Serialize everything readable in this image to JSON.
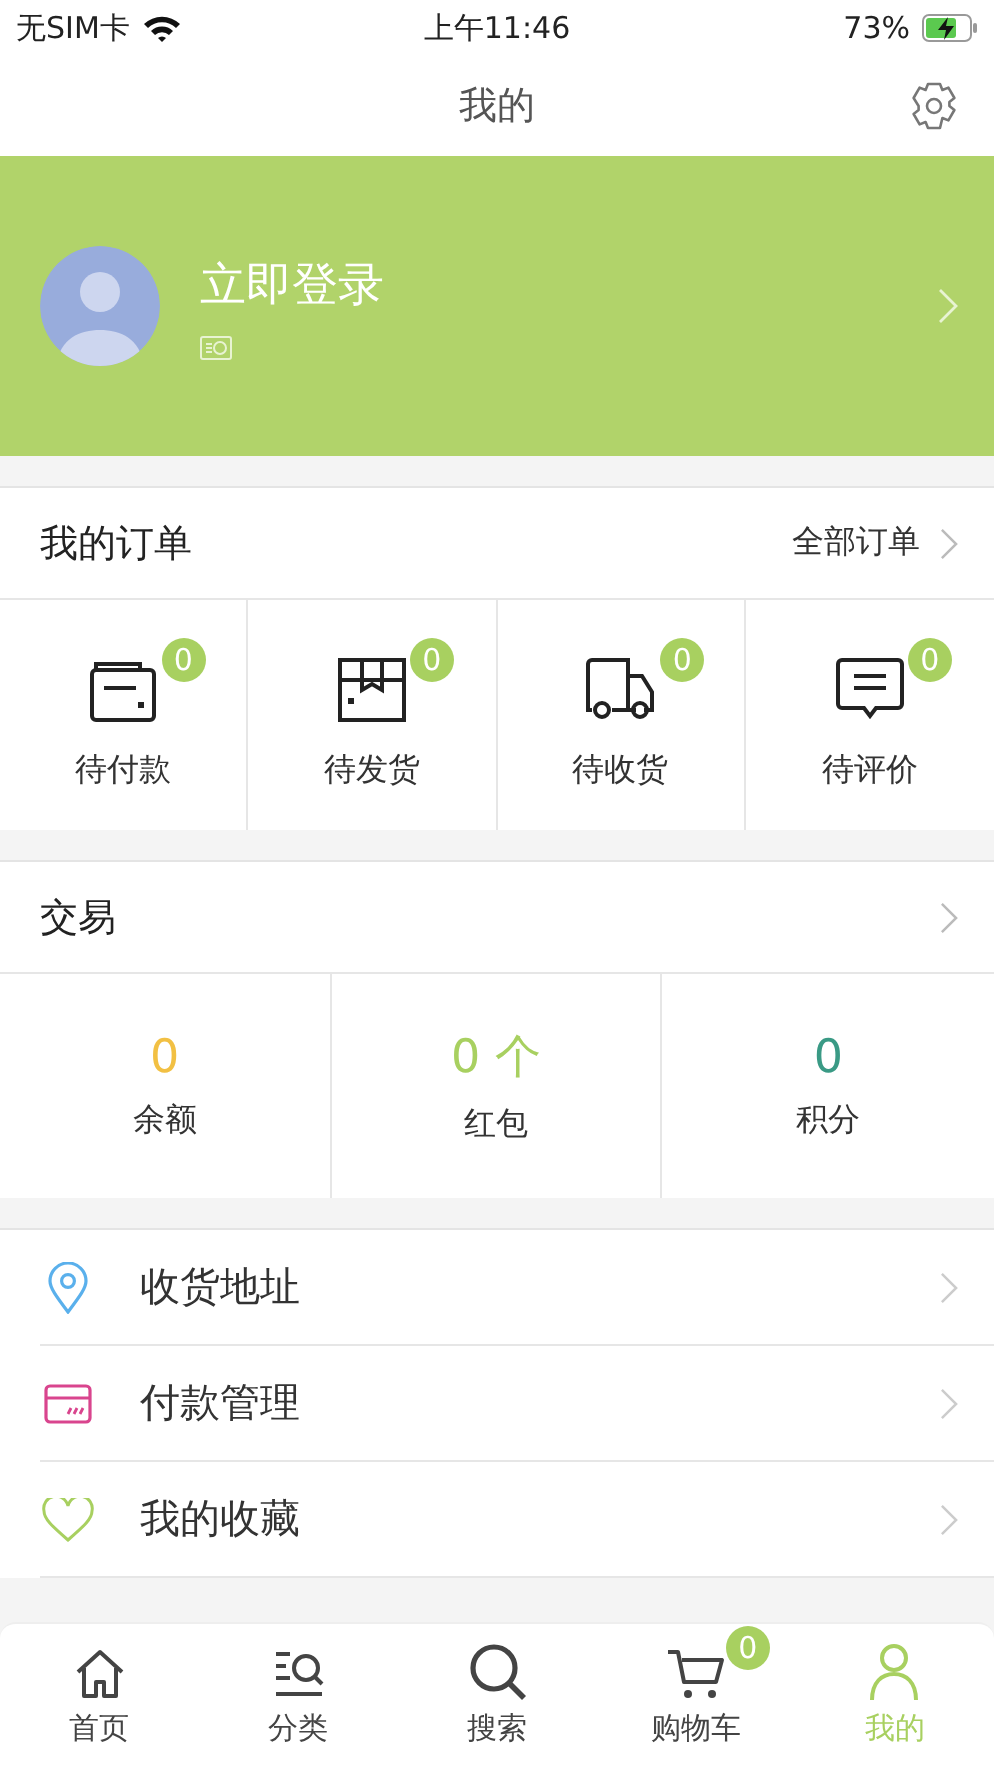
{
  "status_bar": {
    "carrier": "无SIM卡",
    "time": "上午11:46",
    "battery": "73%"
  },
  "nav": {
    "title": "我的"
  },
  "profile": {
    "login": "立即登录"
  },
  "orders": {
    "title": "我的订单",
    "link": "全部订单",
    "items": [
      {
        "kind": "pay",
        "label": "待付款",
        "count": "0"
      },
      {
        "kind": "ship",
        "label": "待发货",
        "count": "0"
      },
      {
        "kind": "receive",
        "label": "待收货",
        "count": "0"
      },
      {
        "kind": "review",
        "label": "待评价",
        "count": "0"
      }
    ]
  },
  "trade": {
    "title": "交易",
    "stats": [
      {
        "value": "0",
        "label": "余额",
        "color": "#f2c043"
      },
      {
        "value": "0 个",
        "label": "红包",
        "color": "#a8d060"
      },
      {
        "value": "0",
        "label": "积分",
        "color": "#3a9a85"
      }
    ]
  },
  "menu": [
    {
      "kind": "address",
      "label": "收货地址",
      "color": "#5ab0ec"
    },
    {
      "kind": "payment",
      "label": "付款管理",
      "color": "#d9458e"
    },
    {
      "kind": "favorite",
      "label": "我的收藏",
      "color": "#a8d060"
    }
  ],
  "tabbar": [
    {
      "kind": "home",
      "label": "首页",
      "selected": false
    },
    {
      "kind": "category",
      "label": "分类",
      "selected": false
    },
    {
      "kind": "search",
      "label": "搜索",
      "selected": false
    },
    {
      "kind": "cart",
      "label": "购物车",
      "selected": false,
      "badge": "0"
    },
    {
      "kind": "profile",
      "label": "我的",
      "selected": true
    }
  ]
}
